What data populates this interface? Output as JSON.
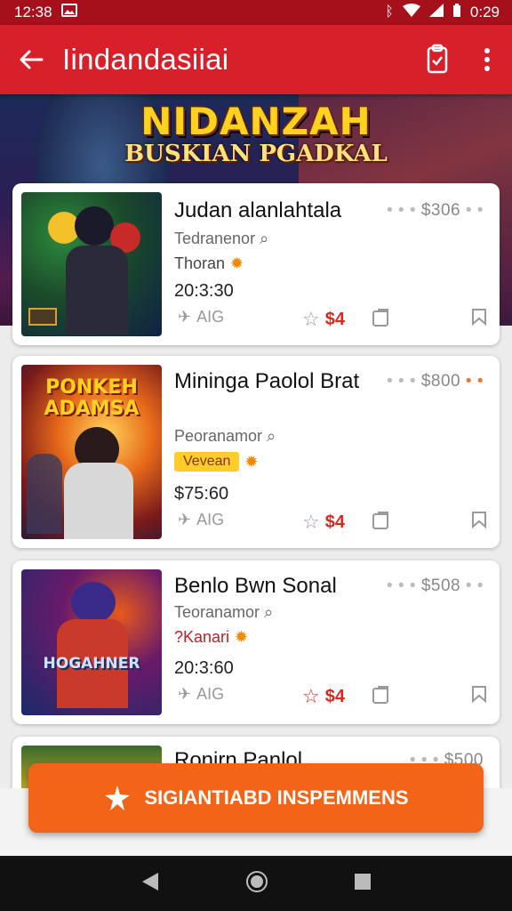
{
  "status_bar": {
    "time": "12:38",
    "clock": "0:29"
  },
  "app_bar": {
    "title": "Iindandasiiai"
  },
  "banner": {
    "title": "NIDANZAH",
    "subtitle": "BUSKIAN PGADKAL"
  },
  "colors": {
    "app_bar": "#d8202a",
    "status_bar": "#a5101a",
    "cta": "#f26418",
    "rating": "#d82a20"
  },
  "items": [
    {
      "title": "Judan alanlahtala",
      "price": "$306",
      "meta": "Tedranenor",
      "category": "Thoran",
      "number": "20:3:30",
      "action_share": "AIG",
      "rating": "$4",
      "thumb_label": ""
    },
    {
      "title": "Mininga Paolol Brat",
      "price": "$800",
      "meta": "Peoranamor",
      "category_tag": "Vevean",
      "number": "$75:60",
      "action_share": "AIG",
      "rating": "$4",
      "thumb_label": "PONKEH ADAMSA"
    },
    {
      "title": "Benlo Bwn Sonal",
      "price": "$508",
      "meta": "Teoranamor",
      "category": "?Kanari",
      "number": "20:3:60",
      "action_share": "AIG",
      "rating": "$4",
      "thumb_label": "HOGAHNER"
    },
    {
      "title": "Ronirn Panlol",
      "price": "$500"
    }
  ],
  "cta": {
    "label": "SIGIANTIABD INSPEMMENS"
  }
}
